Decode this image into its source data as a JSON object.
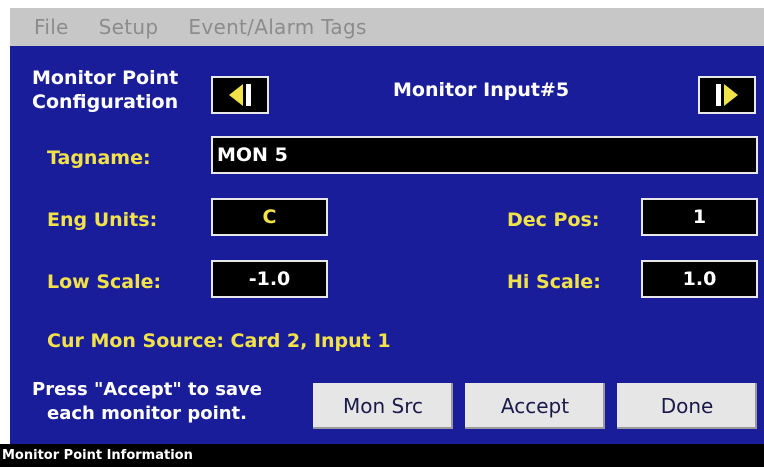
{
  "menu": {
    "file": "File",
    "setup": "Setup",
    "event_alarm_tags": "Event/Alarm Tags"
  },
  "header": {
    "title_line1": "Monitor Point",
    "title_line2": "Configuration",
    "current_input": "Monitor Input#5"
  },
  "icons": {
    "prev": "prev-arrow-icon",
    "next": "next-arrow-icon"
  },
  "form": {
    "tagname_label": "Tagname:",
    "tagname_value": "MON 5",
    "eng_units_label": "Eng Units:",
    "eng_units_value": "C",
    "dec_pos_label": "Dec Pos:",
    "dec_pos_value": "1",
    "low_scale_label": "Low Scale:",
    "low_scale_value": "-1.0",
    "hi_scale_label": "Hi Scale:",
    "hi_scale_value": "1.0",
    "cur_mon_source": "Cur Mon Source: Card 2, Input 1"
  },
  "footer": {
    "hint_line1": "Press \"Accept\" to save",
    "hint_line2": "each monitor point.",
    "mon_src_label": "Mon Src",
    "accept_label": "Accept",
    "done_label": "Done"
  },
  "status": {
    "text": "Monitor Point Information"
  },
  "colors": {
    "panel_bg": "#1a1d99",
    "label_yellow": "#f2e24a",
    "menubar_bg": "#c7c7c7",
    "button_bg": "#e6e6e6"
  }
}
